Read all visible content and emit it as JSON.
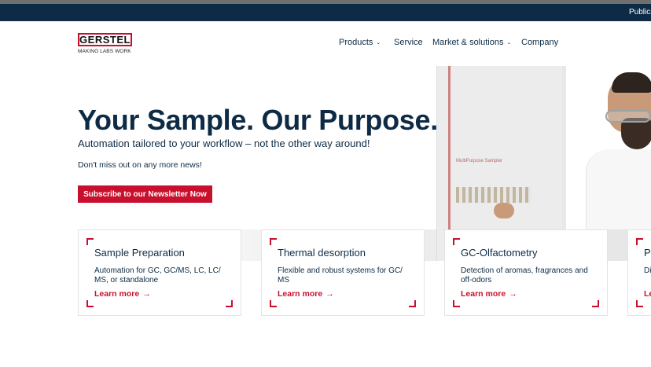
{
  "colors": {
    "brand_red": "#c8102e",
    "navy": "#0d2b45"
  },
  "topbar": {
    "link": "Publica"
  },
  "header": {
    "logo_text": "GERSTEL",
    "logo_tagline": "MAKING LABS WORK",
    "nav": [
      {
        "label": "Products",
        "icon": "chevron-down-icon"
      },
      {
        "label": "Service"
      },
      {
        "label": "Market & solutions",
        "icon": "chevron-down-icon"
      },
      {
        "label": "Company"
      }
    ]
  },
  "hero": {
    "title": "Your Sample. Our Purpose.",
    "subtitle": "Automation tailored to your workflow – not the other way around!",
    "news_text": "Don't miss out on any more news!",
    "cta_label": "Subscribe to our Newsletter Now",
    "image_label": "MultiPurpose Sampler"
  },
  "cards": [
    {
      "title": "Sample Preparation",
      "description": "Automation for GC, GC/MS, LC, LC/ MS, or standalone",
      "link": "Learn more"
    },
    {
      "title": "Thermal desorption",
      "description": "Flexible and robust systems for GC/ MS",
      "link": "Learn more"
    },
    {
      "title": "GC-Olfactometry",
      "description": "Detection of aromas, fragrances and off-odors",
      "link": "Learn more"
    },
    {
      "title": "Pe",
      "description": "Di",
      "link": "Le"
    }
  ]
}
